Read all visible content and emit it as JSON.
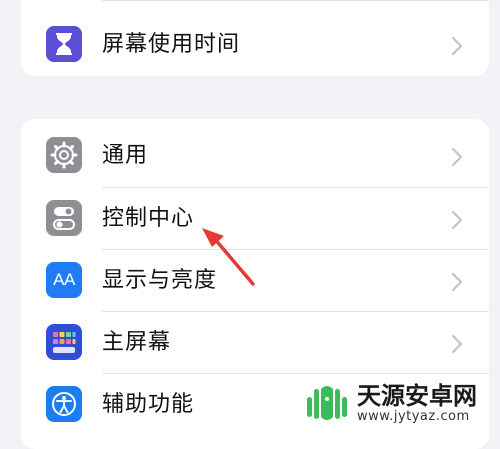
{
  "settings": {
    "top_group": [
      {
        "label": "屏幕使用时间",
        "icon": "hourglass-icon",
        "color": "#5b4fd6"
      }
    ],
    "main_group": [
      {
        "label": "通用",
        "icon": "gear-icon",
        "color": "#8e8e93"
      },
      {
        "label": "控制中心",
        "icon": "toggles-icon",
        "color": "#8e8e93"
      },
      {
        "label": "显示与亮度",
        "icon": "aa-text-icon",
        "color": "#1f7cf5"
      },
      {
        "label": "主屏幕",
        "icon": "home-grid-icon",
        "color": "#2f4fd8"
      },
      {
        "label": "辅助功能",
        "icon": "accessibility-icon",
        "color": "#1a7ef2"
      }
    ],
    "aa_glyph": "AA"
  },
  "annotation": {
    "type": "red-arrow",
    "points_to": "控制中心",
    "color": "#e53935"
  },
  "watermark": {
    "name": "天源安卓网",
    "url": "www.jytyaz.com"
  }
}
